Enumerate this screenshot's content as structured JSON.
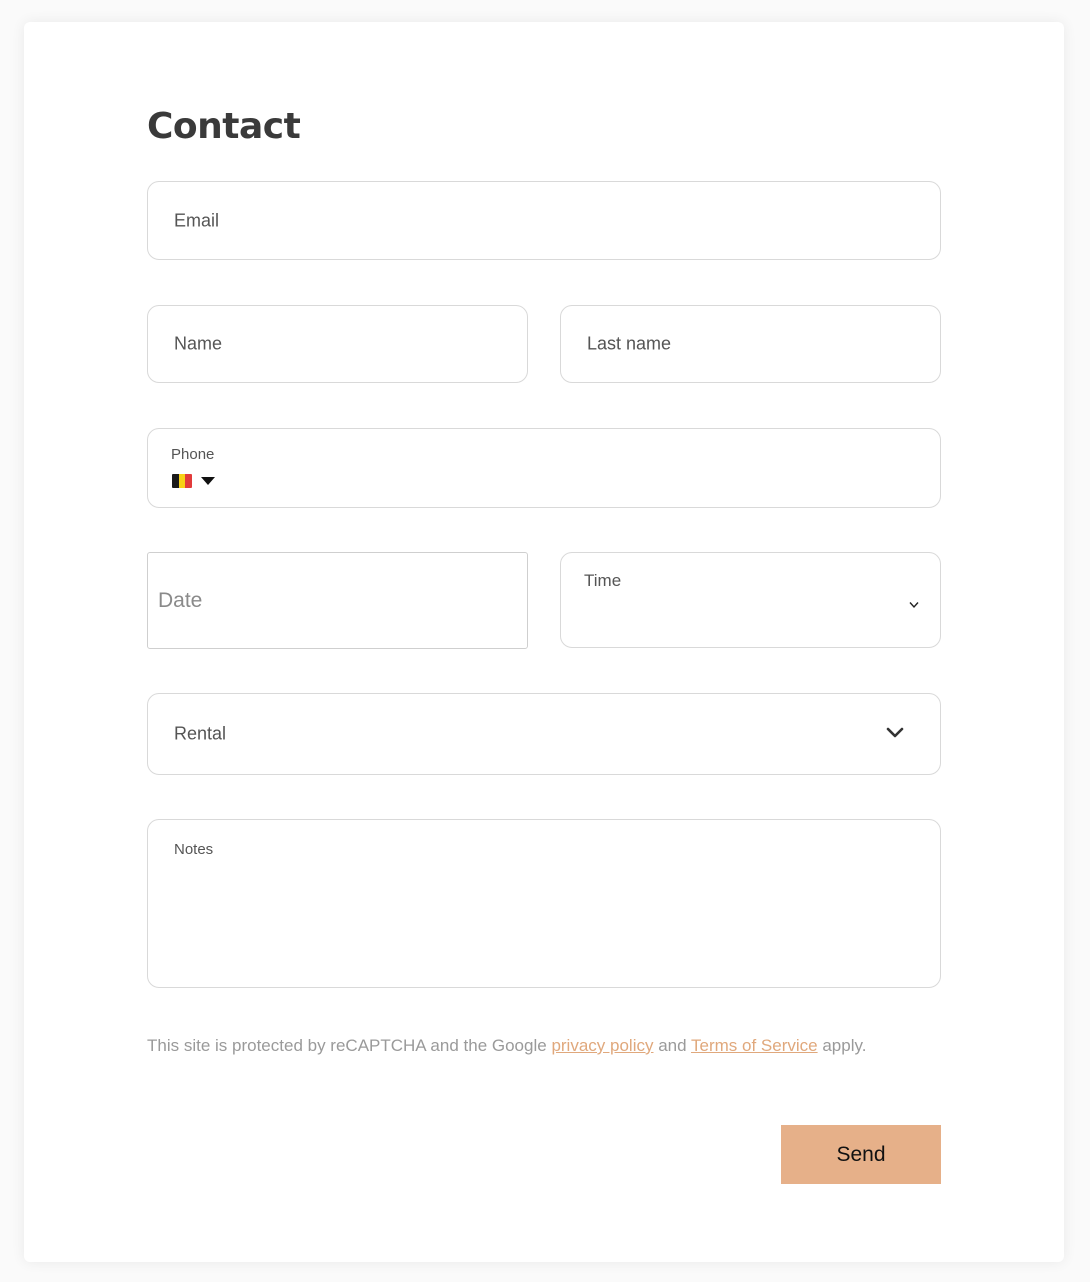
{
  "form": {
    "title": "Contact",
    "email_label": "Email",
    "name_label": "Name",
    "last_name_label": "Last name",
    "phone_label": "Phone",
    "phone_country_flag": "belgium-flag",
    "phone_country_flag_colors": [
      "#1a1a1a",
      "#f7d116",
      "#e23b3b"
    ],
    "date_placeholder": "Date",
    "time_label": "Time",
    "rental_label": "Rental",
    "notes_label": "Notes",
    "legal": {
      "prefix": "This site is protected by reCAPTCHA and the Google",
      "privacy_link": "privacy policy",
      "and": "and",
      "terms_link": "Terms of Service",
      "suffix": "apply."
    },
    "send_label": "Send"
  },
  "colors": {
    "accent": "#e6b089",
    "link": "#e0a87c"
  }
}
